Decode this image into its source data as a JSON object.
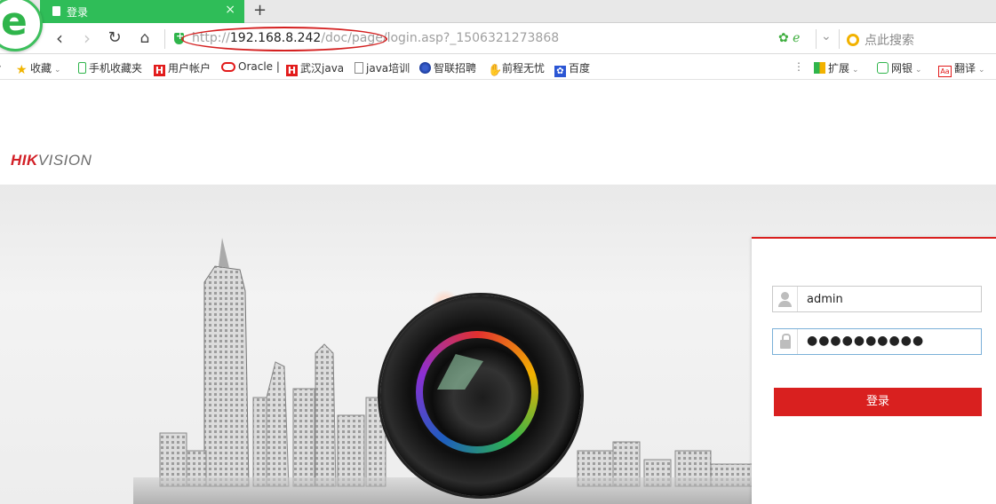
{
  "browser": {
    "tab": {
      "title": "登录",
      "close": "×"
    },
    "new_tab": "+",
    "url": {
      "protocol": "http://",
      "host": "192.168.8.242",
      "path": "/doc/page/login.asp?_1506321273868"
    },
    "search_placeholder": "点此搜索",
    "bookmarks": [
      {
        "label": "收藏",
        "icon": "star-icon"
      },
      {
        "label": "手机收藏夹",
        "icon": "phone-icon"
      },
      {
        "label": "用户帐户",
        "icon": "h-icon"
      },
      {
        "label": "Oracle |",
        "icon": "oracle-icon"
      },
      {
        "label": "武汉java",
        "icon": "h-icon"
      },
      {
        "label": "java培训",
        "icon": "doc-icon"
      },
      {
        "label": "智联招聘",
        "icon": "globe-icon"
      },
      {
        "label": "前程无忧",
        "icon": "hand-icon"
      },
      {
        "label": "百度",
        "icon": "paw-icon"
      }
    ],
    "toolbar_right": [
      {
        "label": "扩展",
        "icon": "grid-icon"
      },
      {
        "label": "网银",
        "icon": "bank-icon"
      },
      {
        "label": "翻译",
        "icon": "translate-icon"
      }
    ]
  },
  "page": {
    "logo": {
      "brand_red": "HIK",
      "brand_gray": "VISION"
    },
    "login": {
      "username": "admin",
      "password_mask": "●●●●●●●●●●",
      "submit_label": "登录"
    }
  },
  "colors": {
    "browser_green": "#2fbd58",
    "brand_red": "#d9201f",
    "annotation_red": "#d42020"
  }
}
